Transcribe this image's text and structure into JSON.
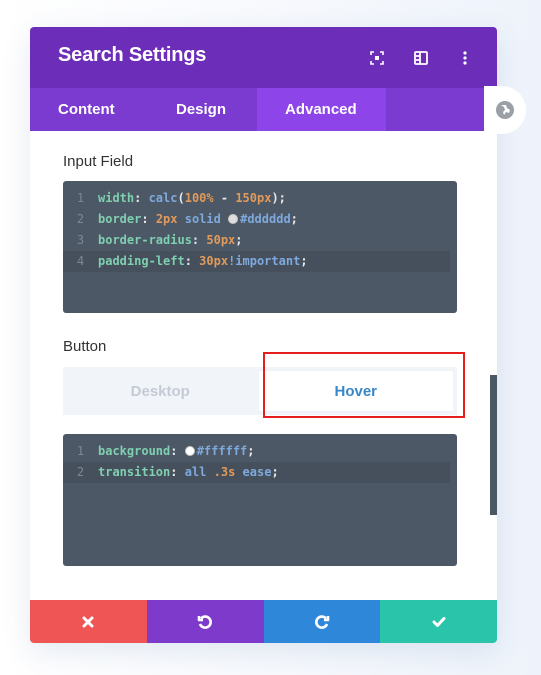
{
  "header": {
    "title": "Search Settings",
    "icons": [
      "fullscreen-icon",
      "split-view-icon",
      "more-options-icon"
    ]
  },
  "tabs": [
    {
      "label": "Content",
      "active": false
    },
    {
      "label": "Design",
      "active": false
    },
    {
      "label": "Advanced",
      "active": true
    }
  ],
  "input_field": {
    "label": "Input Field",
    "lines": [
      {
        "num": "1",
        "prop": "width",
        "tokens": [
          {
            "t": "v",
            "s": "calc"
          },
          {
            "t": "p",
            "s": "("
          },
          {
            "t": "n",
            "s": "100%"
          },
          {
            "t": "p",
            "s": " - "
          },
          {
            "t": "n",
            "s": "150px"
          },
          {
            "t": "p",
            "s": ");"
          }
        ]
      },
      {
        "num": "2",
        "prop": "border",
        "tokens": [
          {
            "t": "n",
            "s": "2px"
          },
          {
            "t": "p",
            "s": " "
          },
          {
            "t": "v",
            "s": "solid"
          },
          {
            "t": "p",
            "s": " "
          },
          {
            "t": "swatch",
            "s": "#dddddd"
          },
          {
            "t": "v",
            "s": "#dddddd"
          },
          {
            "t": "p",
            "s": ";"
          }
        ]
      },
      {
        "num": "3",
        "prop": "border-radius",
        "tokens": [
          {
            "t": "n",
            "s": "50px"
          },
          {
            "t": "p",
            "s": ";"
          }
        ]
      },
      {
        "num": "4",
        "prop": "padding-left",
        "tokens": [
          {
            "t": "n",
            "s": "30px"
          },
          {
            "t": "v",
            "s": "!important"
          },
          {
            "t": "p",
            "s": ";"
          }
        ],
        "current": true
      }
    ]
  },
  "button": {
    "label": "Button",
    "toggle": {
      "desktop": "Desktop",
      "hover": "Hover",
      "selected": "Hover"
    },
    "lines": [
      {
        "num": "1",
        "prop": "background",
        "tokens": [
          {
            "t": "swatch",
            "s": "#ffffff"
          },
          {
            "t": "v",
            "s": "#ffffff"
          },
          {
            "t": "p",
            "s": ";"
          }
        ]
      },
      {
        "num": "2",
        "prop": "transition",
        "tokens": [
          {
            "t": "v",
            "s": "all"
          },
          {
            "t": "p",
            "s": " "
          },
          {
            "t": "n",
            "s": ".3s"
          },
          {
            "t": "p",
            "s": " "
          },
          {
            "t": "v",
            "s": "ease"
          },
          {
            "t": "p",
            "s": ";"
          }
        ],
        "current": true
      }
    ]
  },
  "footer": {
    "buttons": [
      "cancel",
      "undo",
      "redo",
      "save"
    ]
  },
  "colors": {
    "header": "#6c2eb9",
    "tabs": "#7b3bd0",
    "tab_active": "#8d44e8",
    "cancel": "#ef5555",
    "undo": "#7e3bcb",
    "redo": "#2e87d8",
    "save": "#29c4a9",
    "highlight": "#e61e1e"
  }
}
